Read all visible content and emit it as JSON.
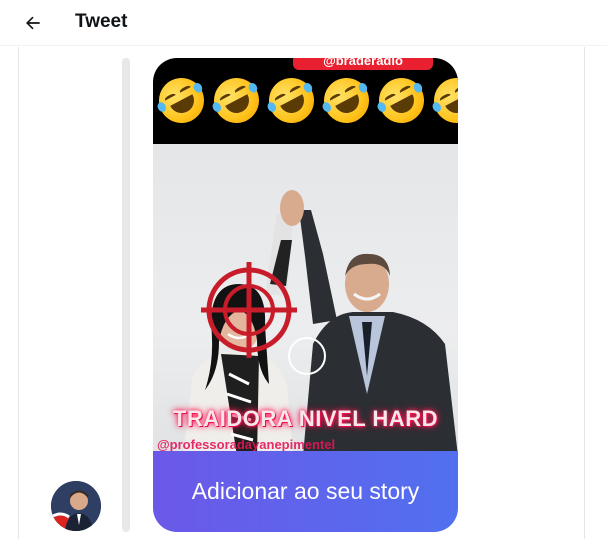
{
  "header": {
    "title": "Tweet",
    "back_icon": "arrow-left-icon"
  },
  "tweet": {
    "media": {
      "top_handle": "@braderadio",
      "emoji_icon": "rolling-on-the-floor-laughing-emoji",
      "emoji_count": 6,
      "caption": "TRAIDORA NIVEL HARD",
      "bottom_handle": "@professoradayanepimentel",
      "story_button_label": "Adicionar ao seu story"
    }
  },
  "colors": {
    "accent_red": "#e8202f",
    "story_button": "#5b66ec",
    "caption_glow": "#ff1a55"
  }
}
